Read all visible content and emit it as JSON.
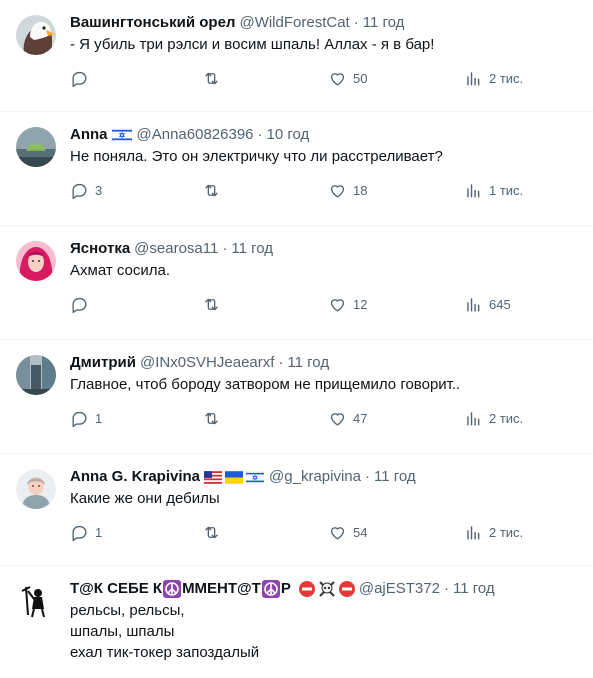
{
  "tweets": [
    {
      "name": "Вашингтонський орел",
      "handle": "@WildForestCat",
      "dot": "·",
      "time": "11 год",
      "text": "- Я убиль три рэлси и восим шпаль! Аллах - я в бар!",
      "replies": "",
      "likes": "50",
      "views": "2 тис."
    },
    {
      "name": "Anna",
      "handle": "@Anna60826396",
      "dot": "·",
      "time": "10 год",
      "text": "Не поняла. Это он электричку что ли расстреливает?",
      "replies": "3",
      "likes": "18",
      "views": "1 тис."
    },
    {
      "name": "Яснотка",
      "handle": "@searosa11",
      "dot": "·",
      "time": "11 год",
      "text": "Ахмат сосила.",
      "replies": "",
      "likes": "12",
      "views": "645"
    },
    {
      "name": "Дмитрий",
      "handle": "@INx0SVHJeaearxf",
      "dot": "·",
      "time": "11 год",
      "text": "Главное, чтоб бороду затвором не прищемило говорит..",
      "replies": "1",
      "likes": "47",
      "views": "2 тис."
    },
    {
      "name": "Anna G. Krapivina",
      "handle": "@g_krapivina",
      "dot": "·",
      "time": "11 год",
      "text": "Какие же они дебилы",
      "replies": "1",
      "likes": "54",
      "views": "2 тис."
    },
    {
      "name_part1": "Т@К СЕБЕ К",
      "name_part2": "ММЕНТ@Т",
      "name_part3": "Р",
      "handle": "@ajEST372",
      "dot": "·",
      "time": "11 год",
      "text": "рельсы, рельсы,\nшпалы, шпалы\nехал тик-токер запоздалый"
    }
  ],
  "icons": {
    "reply": "reply-icon",
    "retweet": "retweet-icon",
    "like": "like-icon",
    "views": "views-icon"
  },
  "colors": {
    "text": "#0f1419",
    "secondary": "#536471",
    "divider": "#eff3f4"
  }
}
